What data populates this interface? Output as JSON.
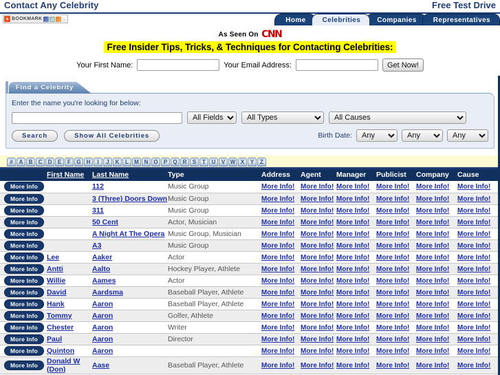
{
  "header": {
    "brand": "Contact Any Celebrity",
    "test_drive": "Free Test Drive",
    "bookmark_label": "BOOKMARK",
    "bookmark_plus": "+",
    "bookmark_dots": ".."
  },
  "nav": {
    "tabs": [
      {
        "label": "Home",
        "active": false
      },
      {
        "label": "Celebrities",
        "active": true
      },
      {
        "label": "Companies",
        "active": false
      },
      {
        "label": "Representatives",
        "active": false
      }
    ]
  },
  "promo": {
    "seen_on": "As Seen On",
    "cnn": "CNN",
    "headline": "Free Insider Tips, Tricks, & Techniques for Contacting Celebrities:",
    "first_name_label": "Your First Name:",
    "first_name_value": "",
    "email_label": "Your Email Address:",
    "email_value": "",
    "get_now": "Get Now!"
  },
  "find_panel": {
    "tab_label": "Find a Celebrity",
    "hint": "Enter the name you're looking for below:",
    "query_value": "",
    "fields_select": "All Fields",
    "types_select": "All Types",
    "causes_select": "All Causes",
    "search_button": "Search",
    "show_all_button": "Show All Celebrities",
    "birth_date_label": "Birth Date:",
    "birth_month": "Any",
    "birth_day": "Any",
    "birth_year": "Any"
  },
  "alpha_bar": {
    "letters": [
      "#",
      "A",
      "B",
      "C",
      "D",
      "E",
      "F",
      "G",
      "H",
      "I",
      "J",
      "K",
      "L",
      "M",
      "N",
      "O",
      "P",
      "Q",
      "R",
      "S",
      "T",
      "U",
      "V",
      "W",
      "X",
      "Y",
      "Z"
    ]
  },
  "table": {
    "more_info_button": "More Info",
    "more_info_link": "More Info!",
    "columns": [
      {
        "label": "",
        "sortable": false
      },
      {
        "label": "First Name",
        "sortable": true
      },
      {
        "label": "Last Name",
        "sortable": true
      },
      {
        "label": "Type",
        "sortable": false
      },
      {
        "label": "Address",
        "sortable": false
      },
      {
        "label": "Agent",
        "sortable": false
      },
      {
        "label": "Manager",
        "sortable": false
      },
      {
        "label": "Publicist",
        "sortable": false
      },
      {
        "label": "Company",
        "sortable": false
      },
      {
        "label": "Cause",
        "sortable": false
      }
    ],
    "rows": [
      {
        "first": "",
        "last": "112",
        "type": "Music Group"
      },
      {
        "first": "",
        "last": "3 (Three) Doors Down",
        "type": "Music Group"
      },
      {
        "first": "",
        "last": "311",
        "type": "Music Group"
      },
      {
        "first": "",
        "last": "50 Cent",
        "type": "Actor, Musician"
      },
      {
        "first": "",
        "last": "A Night At The Opera",
        "type": "Music Group, Musician"
      },
      {
        "first": "",
        "last": "A3",
        "type": "Music Group"
      },
      {
        "first": "Lee",
        "last": "Aaker",
        "type": "Actor"
      },
      {
        "first": "Antti",
        "last": "Aalto",
        "type": "Hockey Player, Athlete"
      },
      {
        "first": "Willie",
        "last": "Aames",
        "type": "Actor"
      },
      {
        "first": "David",
        "last": "Aardsma",
        "type": "Baseball Player, Athlete"
      },
      {
        "first": "Hank",
        "last": "Aaron",
        "type": "Baseball Player, Athlete"
      },
      {
        "first": "Tommy",
        "last": "Aaron",
        "type": "Golfer, Athlete"
      },
      {
        "first": "Chester",
        "last": "Aaron",
        "type": "Writer"
      },
      {
        "first": "Paul",
        "last": "Aaron",
        "type": "Director"
      },
      {
        "first": "Quinton",
        "last": "Aaron",
        "type": ""
      },
      {
        "first": "Donald W (Don)",
        "last": "Aase",
        "type": "Baseball Player, Athlete"
      }
    ]
  },
  "colors": {
    "navy": "#12305e",
    "brand_blue": "#1f3c75",
    "link_blue": "#1b2ea8",
    "highlight_yellow": "#ffff00",
    "alpha_bg": "#fdfbd4",
    "cnn_red": "#cc0000"
  }
}
